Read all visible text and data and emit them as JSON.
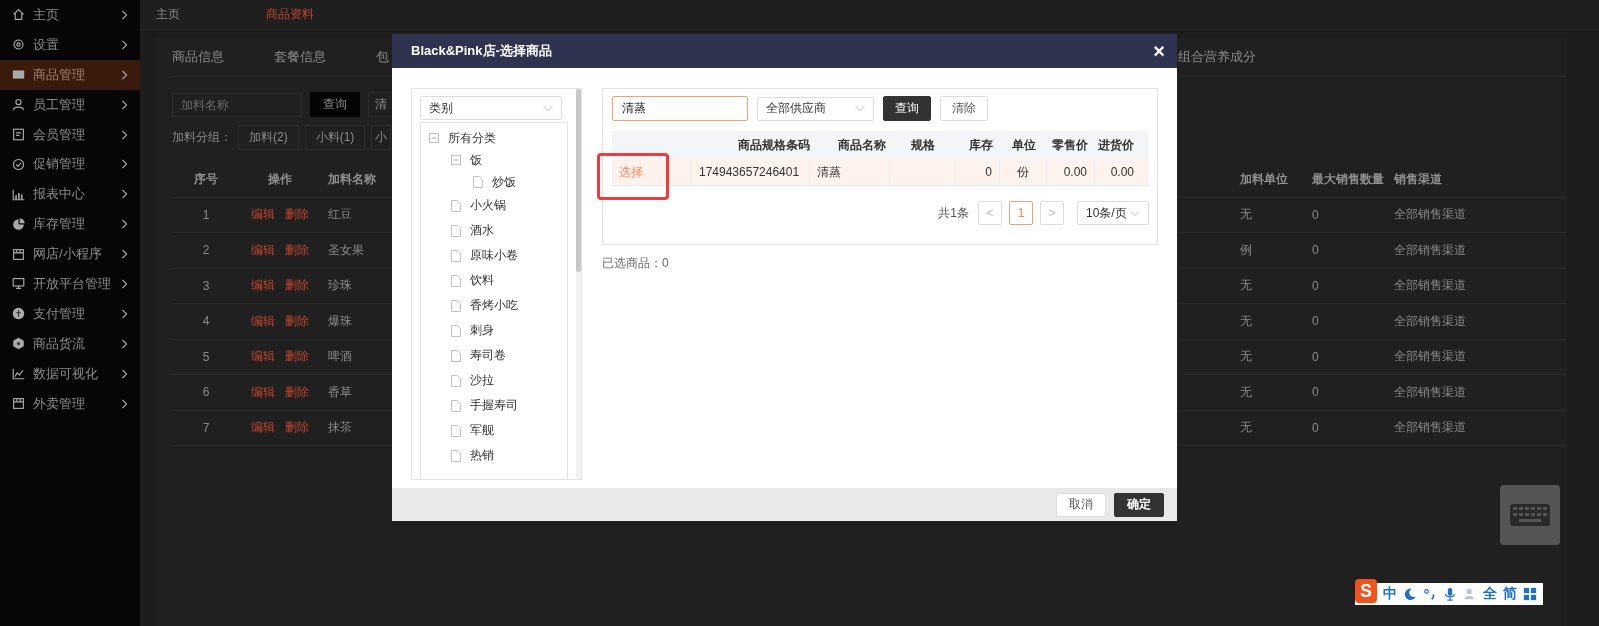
{
  "sidebar": {
    "items": [
      {
        "label": "主页",
        "selected": false
      },
      {
        "label": "设置",
        "selected": false
      },
      {
        "label": "商品管理",
        "selected": true
      },
      {
        "label": "员工管理",
        "selected": false
      },
      {
        "label": "会员管理",
        "selected": false
      },
      {
        "label": "促销管理",
        "selected": false
      },
      {
        "label": "报表中心",
        "selected": false
      },
      {
        "label": "库存管理",
        "selected": false
      },
      {
        "label": "网店/小程序",
        "selected": false
      },
      {
        "label": "开放平台管理",
        "selected": false
      },
      {
        "label": "支付管理",
        "selected": false
      },
      {
        "label": "商品货流",
        "selected": false
      },
      {
        "label": "数据可视化",
        "selected": false
      },
      {
        "label": "外卖管理",
        "selected": false
      }
    ]
  },
  "breadcrumb": [
    {
      "label": "主页",
      "selected": false
    },
    {
      "label": "商品资料",
      "selected": true
    }
  ],
  "page": {
    "tabs": [
      "商品信息",
      "套餐信息",
      "包",
      "组合营养成分"
    ],
    "filter": {
      "placeholder": "加料名称",
      "buttons": [
        {
          "label": "查询",
          "kind": "primary"
        },
        {
          "label": "清",
          "kind": "default"
        }
      ]
    },
    "groups": {
      "label": "加料分组：",
      "items": [
        "加料(2)",
        "小料(1)",
        "小"
      ]
    },
    "table": {
      "columns": [
        "序号",
        "操作",
        "加料名称",
        "加料单位",
        "最大销售数量",
        "销售渠道"
      ],
      "rows": [
        {
          "index": "1",
          "actions": [
            "编辑",
            "删除"
          ],
          "name": "红豆",
          "unit": "无",
          "max": "0",
          "channel": "全部销售渠道"
        },
        {
          "index": "2",
          "actions": [
            "编辑",
            "删除"
          ],
          "name": "圣女果",
          "unit": "例",
          "max": "0",
          "channel": "全部销售渠道"
        },
        {
          "index": "3",
          "actions": [
            "编辑",
            "删除"
          ],
          "name": "珍珠",
          "unit": "无",
          "max": "0",
          "channel": "全部销售渠道"
        },
        {
          "index": "4",
          "actions": [
            "编辑",
            "删除"
          ],
          "name": "爆珠",
          "unit": "无",
          "max": "0",
          "channel": "全部销售渠道"
        },
        {
          "index": "5",
          "actions": [
            "编辑",
            "删除"
          ],
          "name": "啤酒",
          "unit": "无",
          "max": "0",
          "channel": "全部销售渠道"
        },
        {
          "index": "6",
          "actions": [
            "编辑",
            "删除"
          ],
          "name": "香草",
          "unit": "无",
          "max": "0",
          "channel": "全部销售渠道"
        },
        {
          "index": "7",
          "actions": [
            "编辑",
            "删除"
          ],
          "name": "抹茶",
          "unit": "无",
          "max": "0",
          "channel": "全部销售渠道"
        }
      ]
    }
  },
  "modal": {
    "title": "Black&Pink店-选择商品",
    "close": "×",
    "category_select": "类别",
    "tree": [
      {
        "label": "所有分类",
        "expanded": true,
        "children": [
          {
            "label": "饭",
            "expanded": true,
            "children": [
              {
                "label": "炒饭"
              }
            ]
          },
          {
            "label": "小火锅"
          },
          {
            "label": "酒水"
          },
          {
            "label": "原味小卷"
          },
          {
            "label": "饮料"
          },
          {
            "label": "香烤小吃"
          },
          {
            "label": "刺身"
          },
          {
            "label": "寿司卷"
          },
          {
            "label": "沙拉"
          },
          {
            "label": "手握寿司"
          },
          {
            "label": "军舰"
          },
          {
            "label": "热销"
          }
        ]
      }
    ],
    "search": {
      "value": "清蒸"
    },
    "supplier_select": "全部供应商",
    "buttons": [
      {
        "label": "查询",
        "kind": "primary"
      },
      {
        "label": "清除",
        "kind": "default"
      }
    ],
    "table": {
      "columns": [
        "商品规格条码",
        "商品名称",
        "规格",
        "库存",
        "单位",
        "零售价",
        "进货价"
      ],
      "rows": [
        {
          "action": "选择",
          "barcode": "174943657246401",
          "name": "清蒸",
          "stock": "0",
          "unit": "份",
          "retail": "0.00",
          "cost": "0.00",
          "highlighted": true
        }
      ]
    },
    "pagination": {
      "total": "共1条",
      "prev": "<",
      "next": ">",
      "pages": [
        {
          "label": "1",
          "selected": true
        }
      ],
      "page_size": "10条/页"
    },
    "selected_count": "已选商品：0",
    "footer": [
      {
        "label": "取消",
        "kind": "default"
      },
      {
        "label": "确定",
        "kind": "primary"
      }
    ]
  },
  "ime_toolbar": {
    "logo": "S",
    "labels": [
      "中",
      "全",
      "简"
    ]
  }
}
